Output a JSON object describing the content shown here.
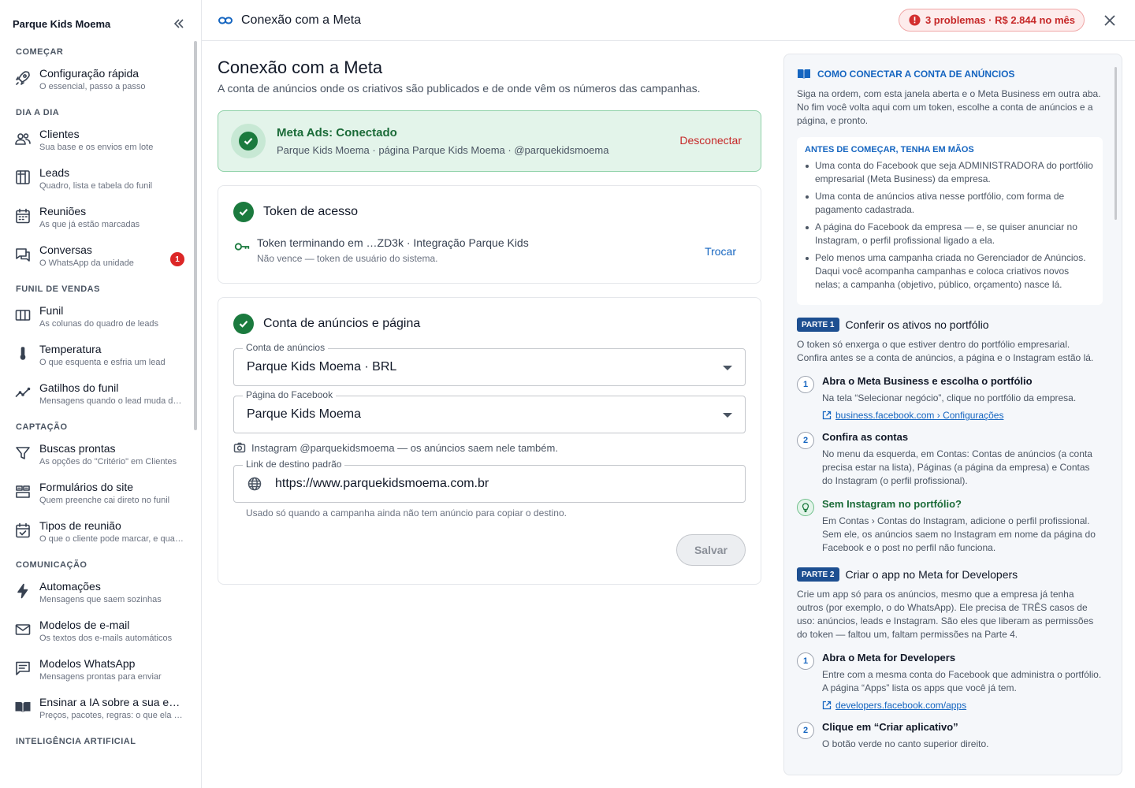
{
  "sidebar": {
    "title": "Parque Kids Moema",
    "sections": [
      {
        "label": "COMEÇAR",
        "items": [
          {
            "label": "Configuração rápida",
            "sub": "O essencial, passo a passo",
            "icon": "rocket-icon"
          }
        ]
      },
      {
        "label": "DIA A DIA",
        "items": [
          {
            "label": "Clientes",
            "sub": "Sua base e os envios em lote",
            "icon": "people-icon"
          },
          {
            "label": "Leads",
            "sub": "Quadro, lista e tabela do funil",
            "icon": "board-icon"
          },
          {
            "label": "Reuniões",
            "sub": "As que já estão marcadas",
            "icon": "calendar-icon"
          },
          {
            "label": "Conversas",
            "sub": "O WhatsApp da unidade",
            "icon": "chat-icon",
            "badge": "1"
          }
        ]
      },
      {
        "label": "FUNIL DE VENDAS",
        "items": [
          {
            "label": "Funil",
            "sub": "As colunas do quadro de leads",
            "icon": "columns-icon"
          },
          {
            "label": "Temperatura",
            "sub": "O que esquenta e esfria um lead",
            "icon": "thermometer-icon"
          },
          {
            "label": "Gatilhos do funil",
            "sub": "Mensagens quando o lead muda de etapa",
            "icon": "trend-icon"
          }
        ]
      },
      {
        "label": "CAPTAÇÃO",
        "items": [
          {
            "label": "Buscas prontas",
            "sub": "As opções do \"Critério\" em Clientes",
            "icon": "filter-icon"
          },
          {
            "label": "Formulários do site",
            "sub": "Quem preenche cai direto no funil",
            "icon": "form-icon"
          },
          {
            "label": "Tipos de reunião",
            "sub": "O que o cliente pode marcar, e quando",
            "icon": "calendar-check-icon"
          }
        ]
      },
      {
        "label": "COMUNICAÇÃO",
        "items": [
          {
            "label": "Automações",
            "sub": "Mensagens que saem sozinhas",
            "icon": "bolt-icon"
          },
          {
            "label": "Modelos de e-mail",
            "sub": "Os textos dos e-mails automáticos",
            "icon": "mail-icon"
          },
          {
            "label": "Modelos WhatsApp",
            "sub": "Mensagens prontas para enviar",
            "icon": "message-icon"
          },
          {
            "label": "Ensinar a IA sobre a sua empresa",
            "sub": "Preços, pacotes, regras: o que ela precisa saber",
            "icon": "book-icon"
          }
        ]
      },
      {
        "label": "INTELIGÊNCIA ARTIFICIAL",
        "items": []
      }
    ]
  },
  "topbar": {
    "title": "Conexão com a Meta",
    "problems": "3 problemas · R$ 2.844 no mês"
  },
  "main": {
    "title": "Conexão com a Meta",
    "subtitle": "A conta de anúncios onde os criativos são publicados e de onde vêm os números das campanhas.",
    "status": {
      "title": "Meta Ads: Conectado",
      "sub": "Parque Kids Moema · página Parque Kids Moema · @parquekidsmoema",
      "action": "Desconectar"
    },
    "token": {
      "title": "Token de acesso",
      "line": "Token terminando em …ZD3k · Integração Parque Kids",
      "note": "Não vence — token de usuário do sistema.",
      "action": "Trocar"
    },
    "account": {
      "title": "Conta de anúncios e página",
      "ad_account_label": "Conta de anúncios",
      "ad_account_value": "Parque Kids Moema · BRL",
      "page_label": "Página do Facebook",
      "page_value": "Parque Kids Moema",
      "instagram_note": "Instagram @parquekidsmoema — os anúncios saem nele também.",
      "link_label": "Link de destino padrão",
      "link_value": "https://www.parquekidsmoema.com.br",
      "link_help": "Usado só quando a campanha ainda não tem anúncio para copiar o destino.",
      "save": "Salvar"
    }
  },
  "guide": {
    "title": "COMO CONECTAR A CONTA DE ANÚNCIOS",
    "intro": "Siga na ordem, com esta janela aberta e o Meta Business em outra aba. No fim você volta aqui com um token, escolhe a conta de anúncios e a página, e pronto.",
    "prereq_title": "ANTES DE COMEÇAR, TENHA EM MÃOS",
    "prereqs": [
      "Uma conta do Facebook que seja ADMINISTRADORA do portfólio empresarial (Meta Business) da empresa.",
      "Uma conta de anúncios ativa nesse portfólio, com forma de pagamento cadastrada.",
      "A página do Facebook da empresa — e, se quiser anunciar no Instagram, o perfil profissional ligado a ela.",
      "Pelo menos uma campanha criada no Gerenciador de Anúncios. Daqui você acompanha campanhas e coloca criativos novos nelas; a campanha (objetivo, público, orçamento) nasce lá."
    ],
    "parts": [
      {
        "tag": "PARTE 1",
        "title": "Conferir os ativos no portfólio",
        "desc": "O token só enxerga o que estiver dentro do portfólio empresarial. Confira antes se a conta de anúncios, a página e o Instagram estão lá.",
        "steps": [
          {
            "num": "1",
            "title": "Abra o Meta Business e escolha o portfólio",
            "body": "Na tela “Selecionar negócio”, clique no portfólio da empresa.",
            "link": "business.facebook.com › Configurações"
          },
          {
            "num": "2",
            "title": "Confira as contas",
            "body": "No menu da esquerda, em Contas: Contas de anúncios (a conta precisa estar na lista), Páginas (a página da empresa) e Contas do Instagram (o perfil profissional).",
            "link": ""
          },
          {
            "num": "",
            "tip": true,
            "title": "Sem Instagram no portfólio?",
            "body": "Em Contas › Contas do Instagram, adicione o perfil profissional. Sem ele, os anúncios saem no Instagram em nome da página do Facebook e o post no perfil não funciona.",
            "link": ""
          }
        ]
      },
      {
        "tag": "PARTE 2",
        "title": "Criar o app no Meta for Developers",
        "desc": "Crie um app só para os anúncios, mesmo que a empresa já tenha outros (por exemplo, o do WhatsApp). Ele precisa de TRÊS casos de uso: anúncios, leads e Instagram. São eles que liberam as permissões do token — faltou um, faltam permissões na Parte 4.",
        "steps": [
          {
            "num": "1",
            "title": "Abra o Meta for Developers",
            "body": "Entre com a mesma conta do Facebook que administra o portfólio. A página “Apps” lista os apps que você já tem.",
            "link": "developers.facebook.com/apps"
          },
          {
            "num": "2",
            "title": "Clique em “Criar aplicativo”",
            "body": "O botão verde no canto superior direito.",
            "link": ""
          }
        ]
      }
    ]
  },
  "colors": {
    "accent": "#1565c0",
    "success": "#1b7a3e",
    "danger": "#c62828"
  }
}
